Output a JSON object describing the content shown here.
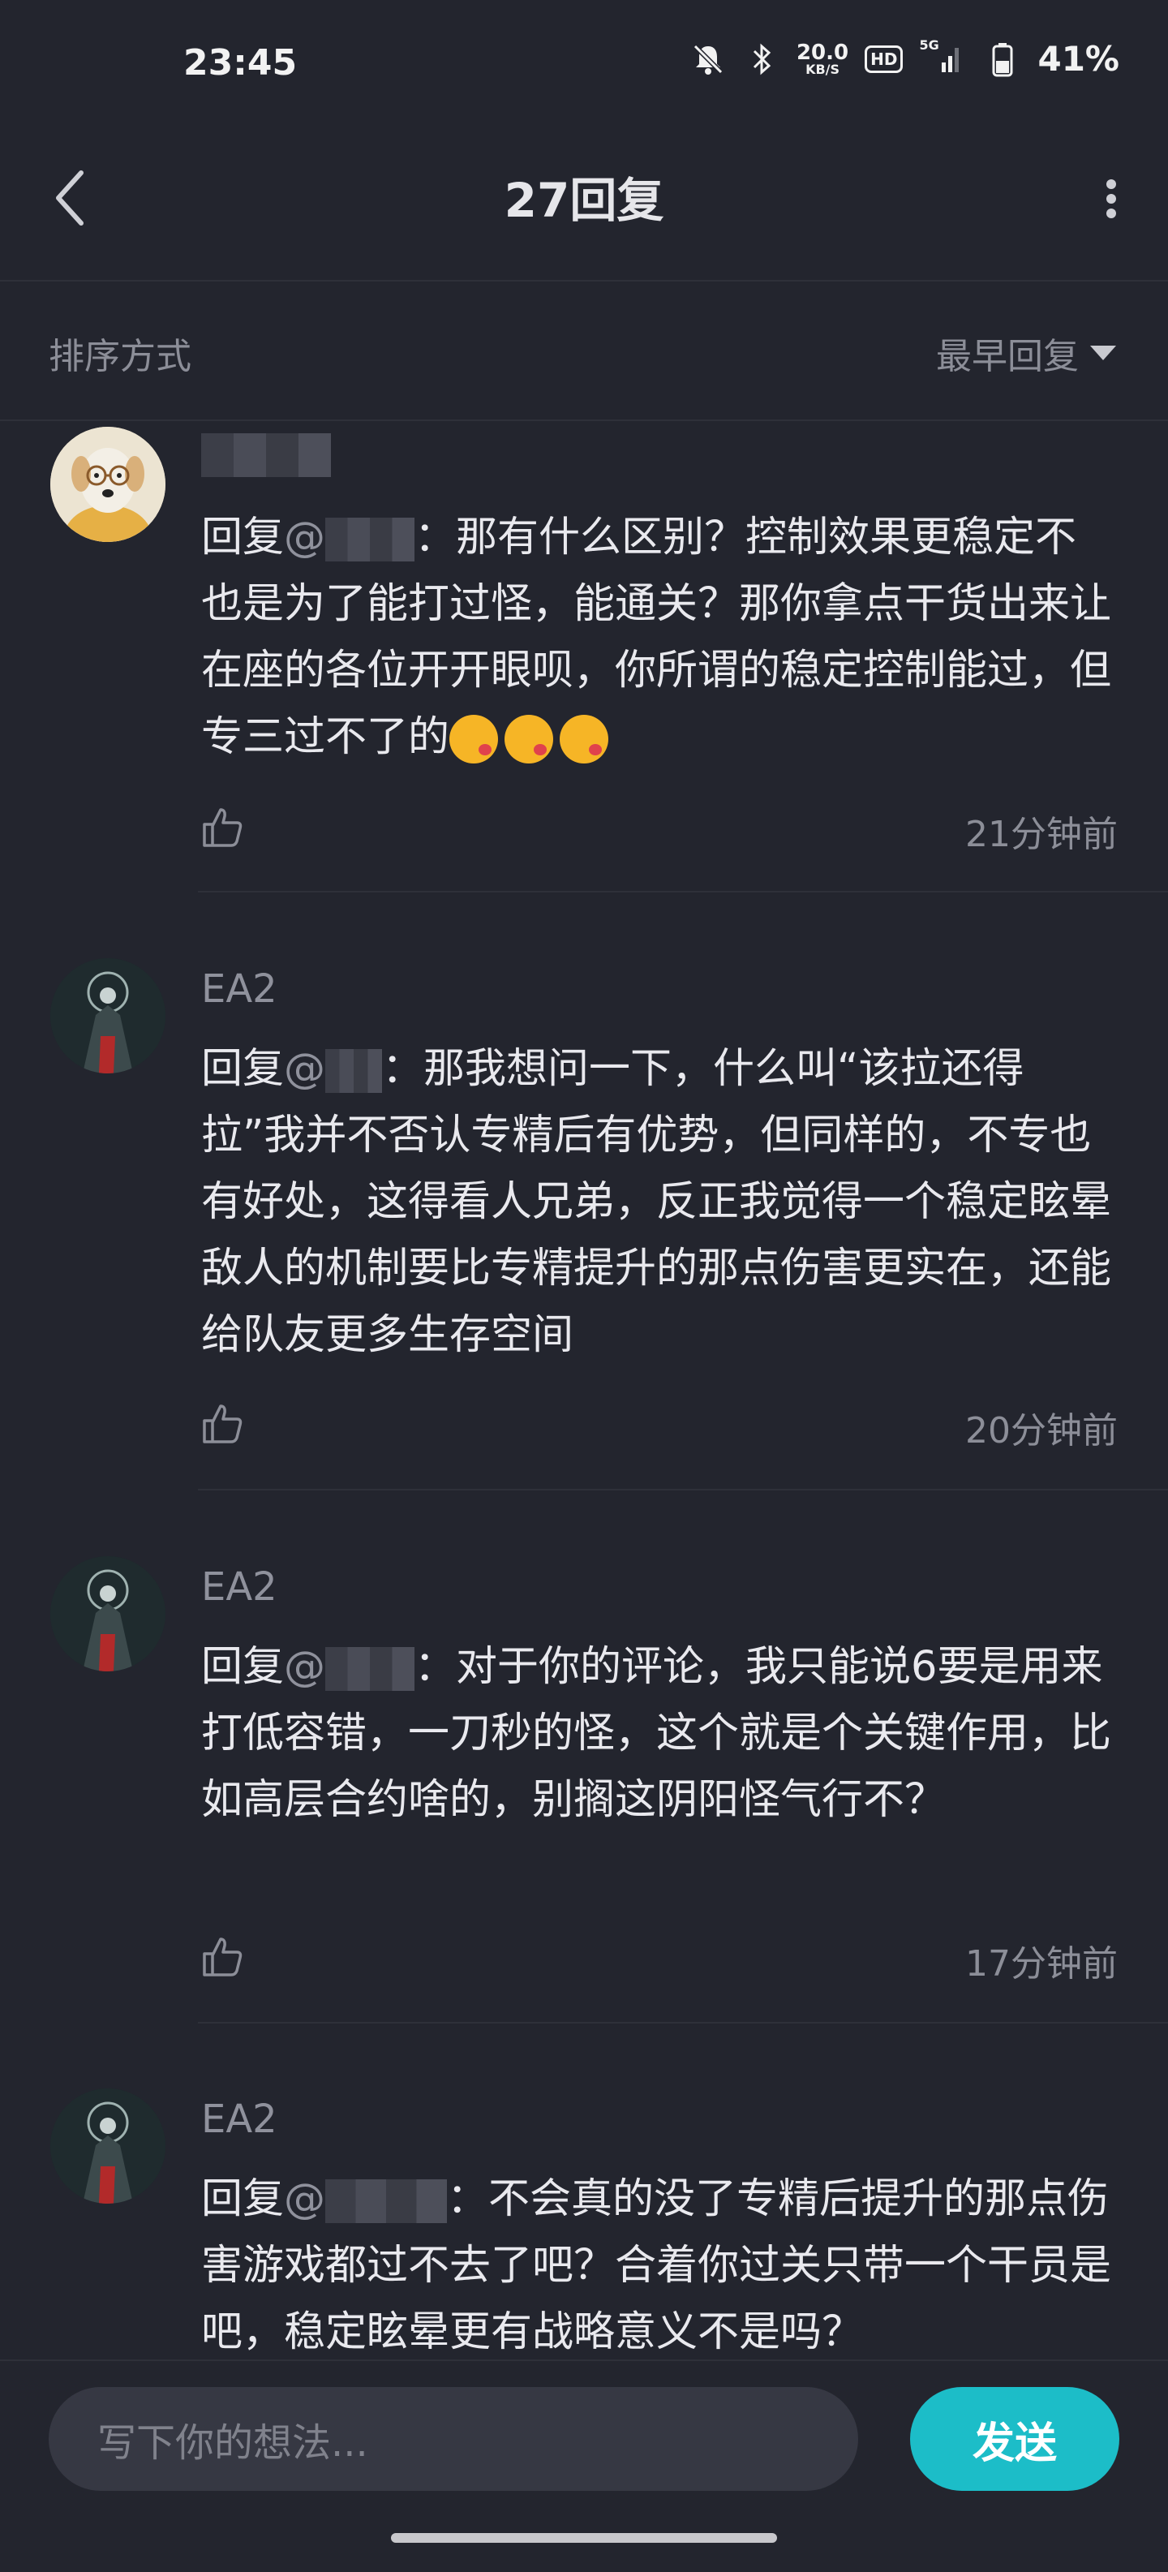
{
  "status": {
    "time": "23:45",
    "net_speed": "20.0",
    "net_unit": "KB/S",
    "hd": "HD",
    "network": "5G",
    "battery": "41%"
  },
  "header": {
    "title": "27回复"
  },
  "sort": {
    "label": "排序方式",
    "value": "最早回复"
  },
  "comments": [
    {
      "username": "",
      "reply_prefix": "回复",
      "at_text": "@",
      "body": "：那有什么区别？控制效果更稳定不也是为了能打过怪，能通关？那你拿点干货出来让在座的各位开开眼呗，你所谓的稳定控制能过，但专三过不了的",
      "emoji": [
        "kissing-face",
        "kissing-face",
        "kissing-face"
      ],
      "time": "21分钟前"
    },
    {
      "username": "EA2",
      "reply_prefix": "回复",
      "at_text": "@",
      "body": "：那我想问一下，什么叫“该拉还得拉”我并不否认专精后有优势，但同样的，不专也有好处，这得看人兄弟，反正我觉得一个稳定眩晕敌人的机制要比专精提升的那点伤害更实在，还能给队友更多生存空间",
      "time": "20分钟前"
    },
    {
      "username": "EA2",
      "reply_prefix": "回复",
      "at_text": "@",
      "body": "：对于你的评论，我只能说6要是用来打低容错，一刀秒的怪，这个就是个关键作用，比如高层合约啥的，别搁这阴阳怪气行不？",
      "time": "17分钟前"
    },
    {
      "username": "EA2",
      "reply_prefix": "回复",
      "at_text": "@",
      "body": "：不会真的没了专精后提升的那点伤害游戏都过不去了吧？合着你过关只带一个干员是吧，稳定眩晕更有战略意义不是吗？",
      "time": ""
    }
  ],
  "composer": {
    "placeholder": "写下你的想法...",
    "send_label": "发送"
  },
  "colors": {
    "background": "#23252e",
    "accent": "#1cbdc8",
    "muted_text": "#8c8e98",
    "text": "#e9e9ee",
    "emoji": "#f6b526"
  }
}
